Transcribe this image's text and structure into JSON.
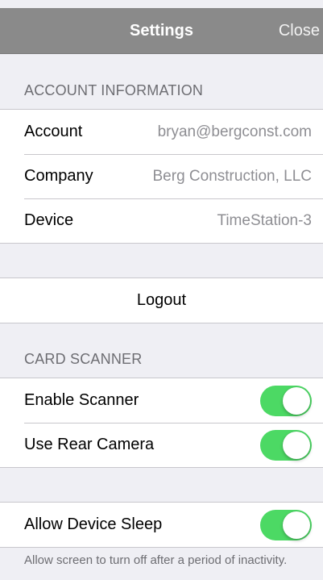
{
  "navbar": {
    "title": "Settings",
    "close_label": "Close"
  },
  "account_section": {
    "header": "ACCOUNT INFORMATION",
    "rows": [
      {
        "label": "Account",
        "value": "bryan@bergconst.com"
      },
      {
        "label": "Company",
        "value": "Berg Construction, LLC"
      },
      {
        "label": "Device",
        "value": "TimeStation-3"
      }
    ]
  },
  "logout": {
    "label": "Logout"
  },
  "scanner_section": {
    "header": "CARD SCANNER",
    "enable_scanner": {
      "label": "Enable Scanner",
      "on": true
    },
    "rear_camera": {
      "label": "Use Rear Camera",
      "on": true
    }
  },
  "sleep_section": {
    "allow_sleep": {
      "label": "Allow Device Sleep",
      "on": true
    },
    "footer": "Allow screen to turn off after a period of inactivity."
  },
  "colors": {
    "toggle_on": "#4cd964",
    "navbar": "#8a8a8a",
    "background": "#efeff4"
  }
}
